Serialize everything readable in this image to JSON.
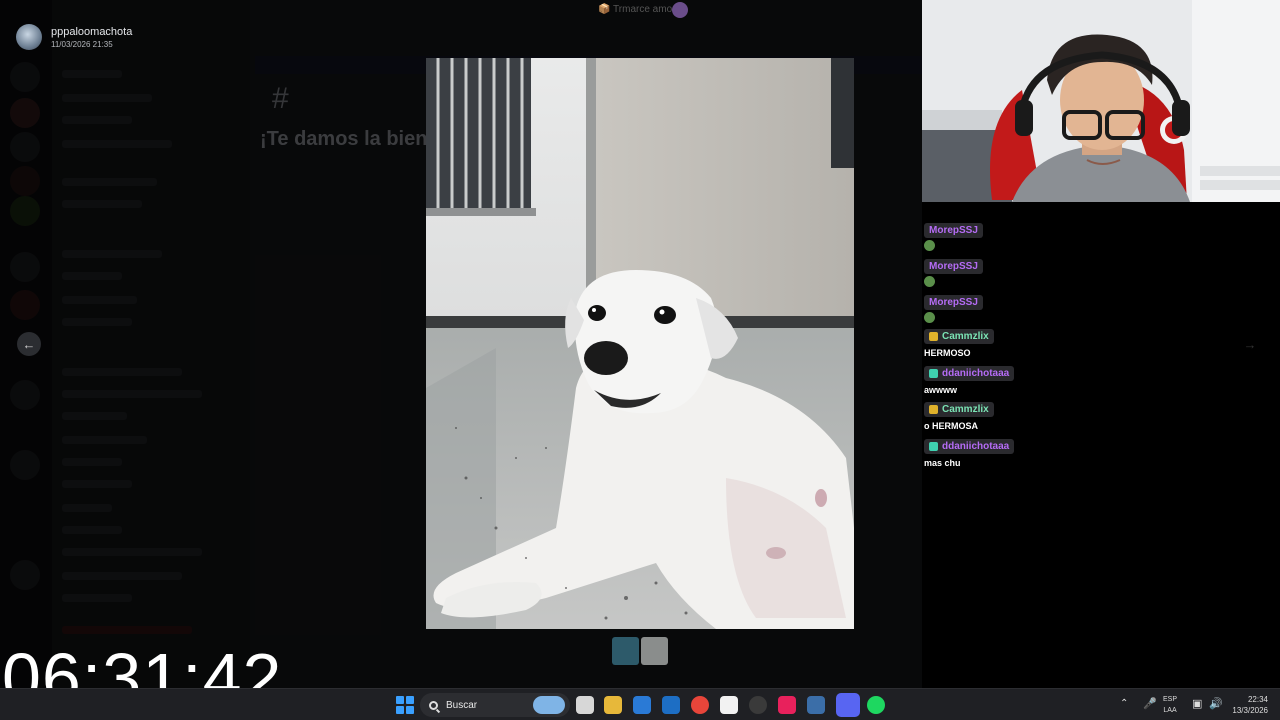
{
  "author": {
    "name": "pppaloomachota",
    "date": "11/03/2026 21:35"
  },
  "top_center": {
    "label": "📦 Trmarce amo"
  },
  "background": {
    "welcome_title": "¡Te damos la bien",
    "hash": "#"
  },
  "stream_chat": [
    {
      "user": "MorepSSJ",
      "color": "#b56cf5",
      "badge": "",
      "text": "",
      "emote": true
    },
    {
      "user": "MorepSSJ",
      "color": "#b56cf5",
      "badge": "",
      "text": "",
      "emote": true
    },
    {
      "user": "MorepSSJ",
      "color": "#b56cf5",
      "badge": "",
      "text": "",
      "emote": true
    },
    {
      "user": "Cammzlix",
      "color": "#7be3b4",
      "badge": "crown",
      "text": "HERMOSO",
      "emote": false
    },
    {
      "user": "ddaniichotaaa",
      "color": "#b56cf5",
      "badge": "grid",
      "text": "awwww",
      "emote": false
    },
    {
      "user": "Cammzlix",
      "color": "#7be3b4",
      "badge": "crown",
      "text": "o HERMOSA",
      "emote": false
    },
    {
      "user": "ddaniichotaaa",
      "color": "#b56cf5",
      "badge": "grid",
      "text": "mas chu",
      "emote": false
    }
  ],
  "stream_timer": "06:31:42",
  "taskbar": {
    "search_placeholder": "Buscar",
    "lang_top": "ESP",
    "lang_bottom": "LAA",
    "time": "22:34",
    "date": "13/3/2026"
  },
  "colors": {
    "accent_blue": "#3aa0ff",
    "discord_bg": "#313338"
  }
}
